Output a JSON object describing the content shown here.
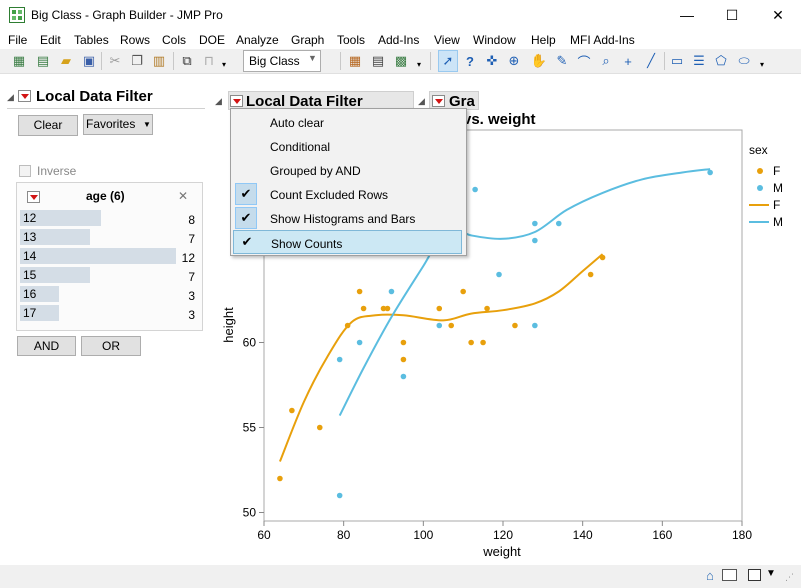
{
  "window": {
    "title": "Big Class - Graph Builder - JMP Pro",
    "minimize": "—",
    "maximize": "☐",
    "close": "✕"
  },
  "menu": [
    "File",
    "Edit",
    "Tables",
    "Rows",
    "Cols",
    "DOE",
    "Analyze",
    "Graph",
    "Tools",
    "Add-Ins",
    "View",
    "Window",
    "Help",
    "MFI Add-Ins"
  ],
  "toolbar": {
    "table_select": "Big Class"
  },
  "left_filter": {
    "title": "Local Data Filter",
    "clear_label": "Clear",
    "favorites_label": "Favorites",
    "inverse_label": "Inverse",
    "age_header": "age (6)",
    "close_glyph": "✕",
    "rows": [
      {
        "label": "12",
        "count": "8",
        "frac": 0.52
      },
      {
        "label": "13",
        "count": "7",
        "frac": 0.45
      },
      {
        "label": "14",
        "count": "12",
        "frac": 1.0
      },
      {
        "label": "15",
        "count": "7",
        "frac": 0.45
      },
      {
        "label": "16",
        "count": "3",
        "frac": 0.25
      },
      {
        "label": "17",
        "count": "3",
        "frac": 0.25
      }
    ],
    "and_label": "AND",
    "or_label": "OR"
  },
  "second_filter": {
    "title": "Local Data Filter"
  },
  "graph_tab": {
    "label": "Gra"
  },
  "chart_title_visible": "vs. weight",
  "popup_menu": [
    {
      "label": "Auto clear",
      "checked": false
    },
    {
      "label": "Conditional",
      "checked": false
    },
    {
      "label": "Grouped by AND",
      "checked": false
    },
    {
      "label": "Count Excluded Rows",
      "checked": true
    },
    {
      "label": "Show Histograms and Bars",
      "checked": true
    },
    {
      "label": "Show Counts",
      "checked": true,
      "selected": true
    }
  ],
  "chart_data": {
    "type": "scatter",
    "xlabel": "weight",
    "ylabel": "height",
    "xlim": [
      60,
      180
    ],
    "ylim": [
      49.5,
      72.5
    ],
    "x_ticks": [
      "60",
      "80",
      "100",
      "120",
      "140",
      "160",
      "180"
    ],
    "y_ticks": [
      "50",
      "55",
      "60"
    ],
    "legend_title": "sex",
    "legend": [
      {
        "label": "F",
        "kind": "point",
        "color": "#e8a00c"
      },
      {
        "label": "M",
        "kind": "point",
        "color": "#5bbde0"
      },
      {
        "label": "F",
        "kind": "line",
        "color": "#e8a00c"
      },
      {
        "label": "M",
        "kind": "line",
        "color": "#5bbde0"
      }
    ],
    "series": [
      {
        "name": "F",
        "color": "#e8a00c",
        "points": [
          [
            64,
            52
          ],
          [
            67,
            56
          ],
          [
            74,
            55
          ],
          [
            81,
            61
          ],
          [
            84,
            63
          ],
          [
            85,
            62
          ],
          [
            90,
            62
          ],
          [
            91,
            62
          ],
          [
            95,
            60
          ],
          [
            95,
            59
          ],
          [
            104,
            62
          ],
          [
            107,
            61
          ],
          [
            110,
            63
          ],
          [
            112,
            60
          ],
          [
            115,
            60
          ],
          [
            116,
            62
          ],
          [
            123,
            61
          ],
          [
            142,
            64
          ],
          [
            145,
            65
          ]
        ]
      },
      {
        "name": "M",
        "color": "#5bbde0",
        "points": [
          [
            79,
            59
          ],
          [
            79,
            51
          ],
          [
            84,
            60
          ],
          [
            92,
            63
          ],
          [
            95,
            58
          ],
          [
            104,
            61
          ],
          [
            113,
            69
          ],
          [
            119,
            64
          ],
          [
            128,
            67
          ],
          [
            128,
            66
          ],
          [
            128,
            61
          ],
          [
            134,
            67
          ],
          [
            172,
            70
          ]
        ]
      }
    ],
    "fits": [
      {
        "name": "F",
        "color": "#e8a00c",
        "points": [
          [
            64,
            53
          ],
          [
            70,
            56.5
          ],
          [
            76,
            59.2
          ],
          [
            82,
            61.2
          ],
          [
            88,
            61.6
          ],
          [
            95,
            61.6
          ],
          [
            105,
            61.3
          ],
          [
            112,
            61.7
          ],
          [
            120,
            61.9
          ],
          [
            128,
            62.3
          ],
          [
            134,
            63
          ],
          [
            140,
            64.2
          ],
          [
            145,
            65.2
          ]
        ]
      },
      {
        "name": "M",
        "color": "#5bbde0",
        "points": [
          [
            79,
            55.7
          ],
          [
            85,
            58.5
          ],
          [
            92,
            61.5
          ],
          [
            100,
            64.5
          ],
          [
            106,
            66.7
          ],
          [
            112,
            66.3
          ],
          [
            120,
            66.1
          ],
          [
            128,
            66.5
          ],
          [
            136,
            67.8
          ],
          [
            145,
            68.8
          ],
          [
            155,
            69.6
          ],
          [
            165,
            70
          ],
          [
            172,
            70.2
          ]
        ]
      }
    ]
  }
}
